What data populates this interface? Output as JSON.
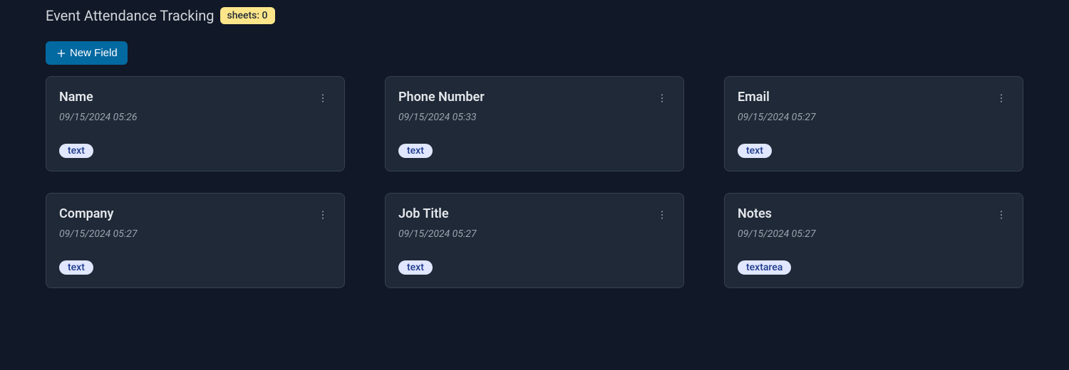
{
  "header": {
    "title": "Event Attendance Tracking",
    "sheets_badge": "sheets: 0"
  },
  "toolbar": {
    "new_field_label": "New Field"
  },
  "cards": [
    {
      "title": "Name",
      "timestamp": "09/15/2024 05:26",
      "type": "text"
    },
    {
      "title": "Phone Number",
      "timestamp": "09/15/2024 05:33",
      "type": "text"
    },
    {
      "title": "Email",
      "timestamp": "09/15/2024 05:27",
      "type": "text"
    },
    {
      "title": "Company",
      "timestamp": "09/15/2024 05:27",
      "type": "text"
    },
    {
      "title": "Job Title",
      "timestamp": "09/15/2024 05:27",
      "type": "text"
    },
    {
      "title": "Notes",
      "timestamp": "09/15/2024 05:27",
      "type": "textarea"
    }
  ]
}
